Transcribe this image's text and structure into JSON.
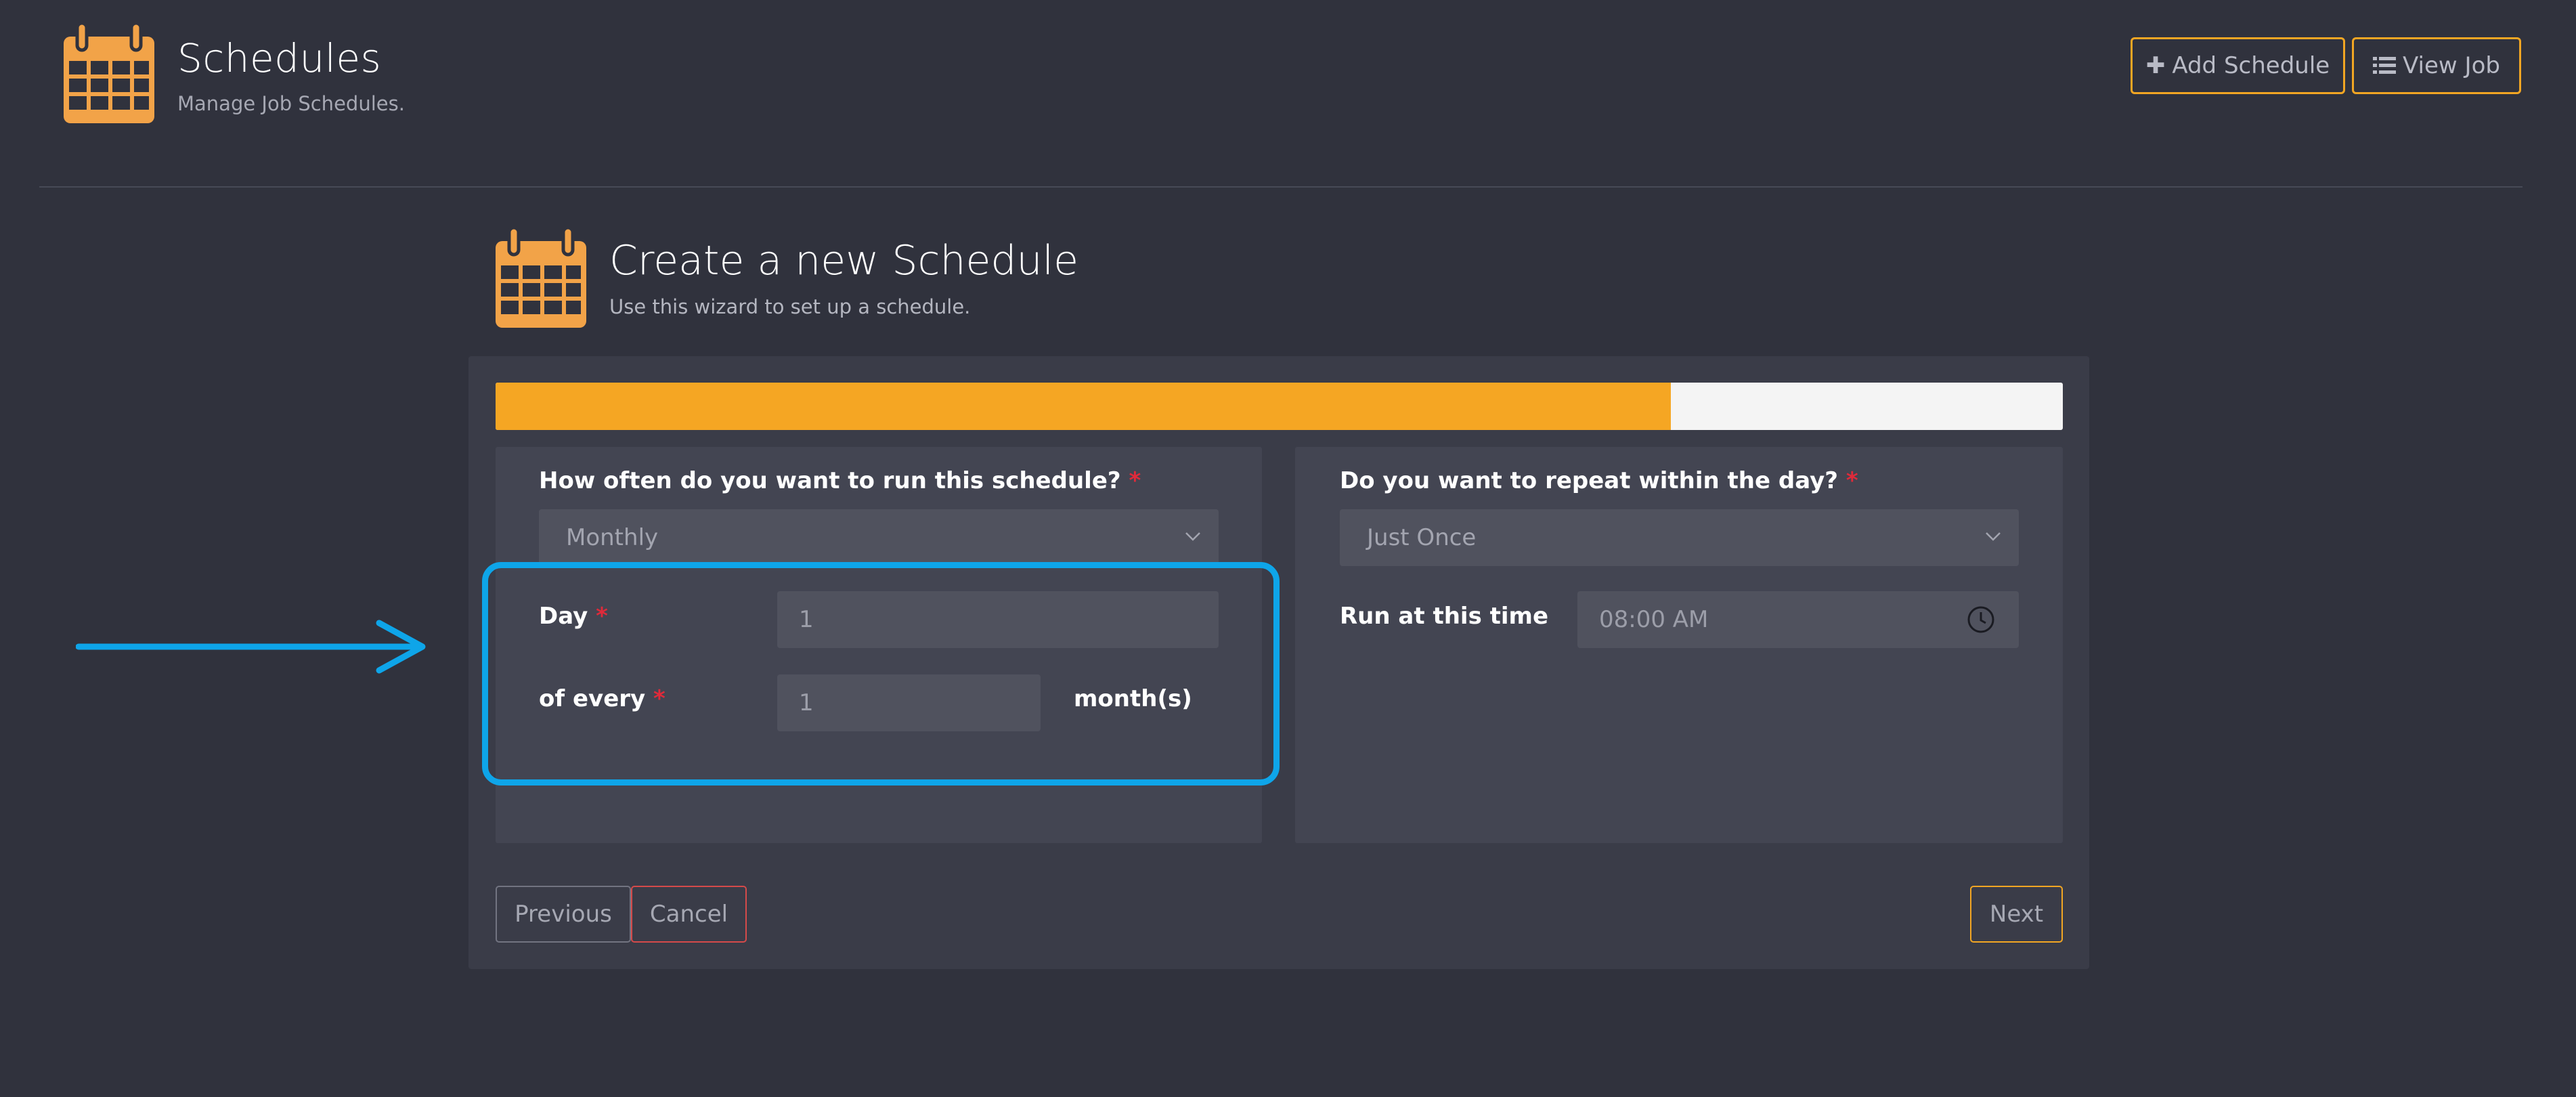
{
  "header": {
    "title": "Schedules",
    "subtitle": "Manage Job Schedules.",
    "add_schedule_label": "Add Schedule",
    "view_job_label": "View Job"
  },
  "wizard": {
    "title": "Create a new Schedule",
    "subtitle": "Use this wizard to set up a schedule.",
    "progress_percent": 75,
    "left_card": {
      "frequency_label": "How often do you want to run this schedule?",
      "frequency_value": "Monthly",
      "day_label": "Day",
      "day_value": "1",
      "every_label": "of every",
      "every_value": "1",
      "every_unit": "month(s)"
    },
    "right_card": {
      "repeat_label": "Do you want to repeat within the day?",
      "repeat_value": "Just Once",
      "time_label": "Run at this time",
      "time_value": "08:00 AM"
    },
    "required_mark": "*",
    "buttons": {
      "previous": "Previous",
      "cancel": "Cancel",
      "next": "Next"
    }
  },
  "colors": {
    "background": "#30323d",
    "accent": "#f5a623",
    "highlight": "#0ea5e9",
    "required": "#e02a3a",
    "cancel_border": "#d54a4a"
  },
  "icons": {
    "header_icon": "calendar-icon",
    "wizard_icon": "calendar-icon",
    "add_icon": "plus-icon",
    "view_icon": "list-icon",
    "chevron": "chevron-down-icon",
    "time_icon": "clock-icon",
    "annotation": "arrow-right-icon"
  }
}
